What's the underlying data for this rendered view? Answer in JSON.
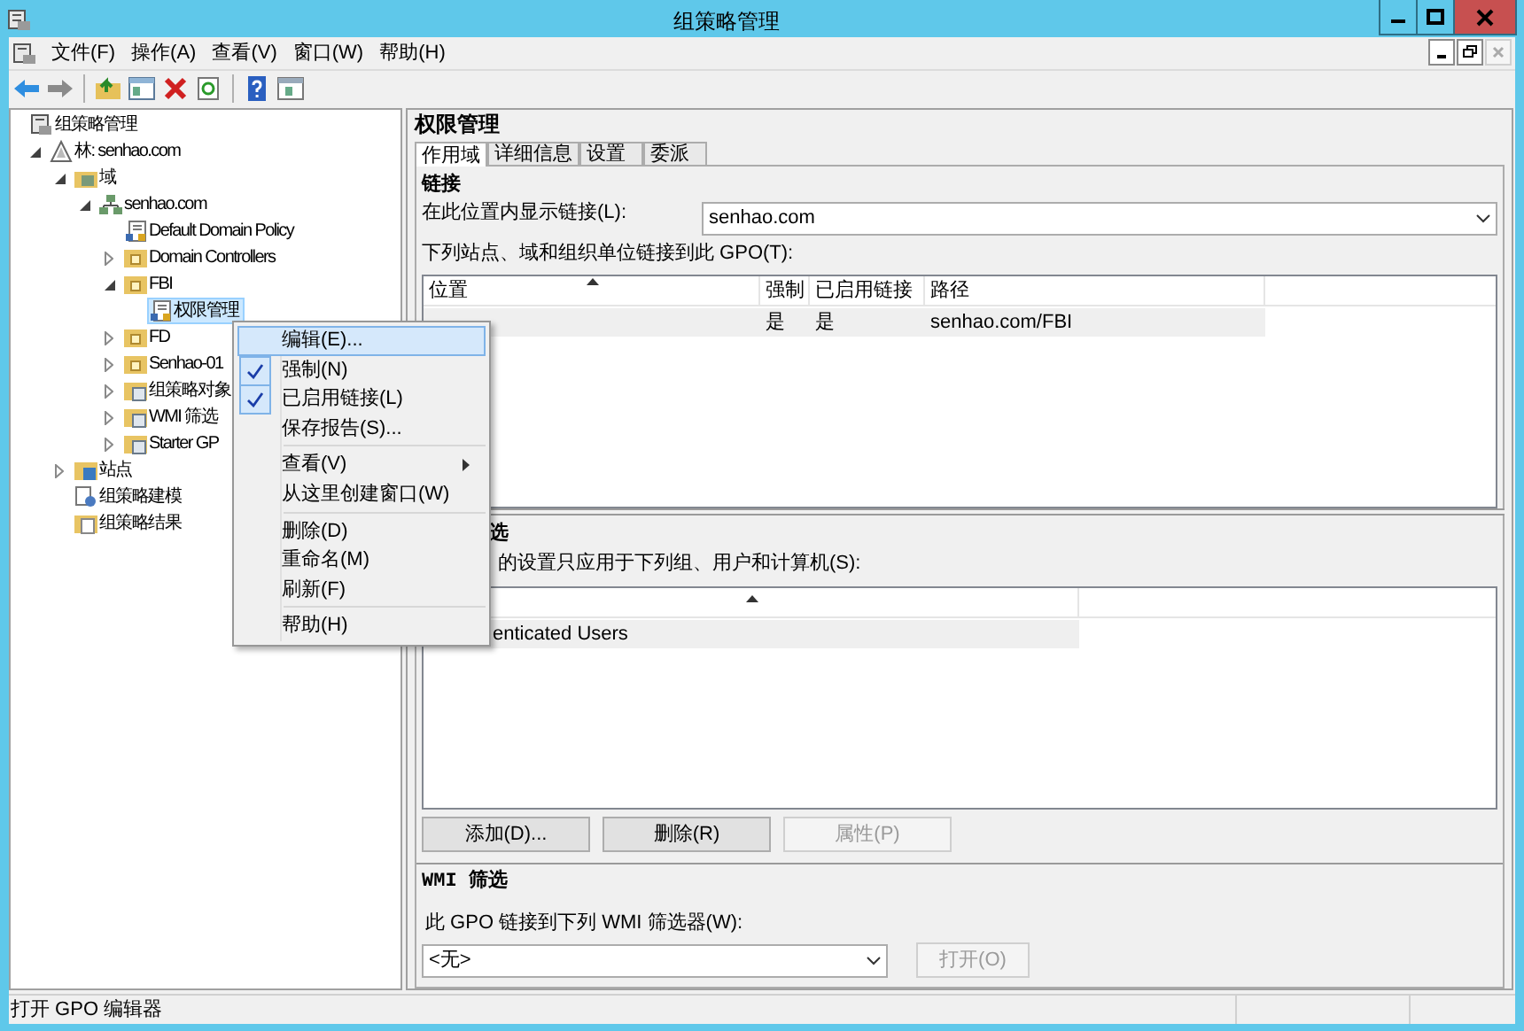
{
  "window": {
    "title": "组策略管理"
  },
  "menu_bar": [
    "文件(F)",
    "操作(A)",
    "查看(V)",
    "窗口(W)",
    "帮助(H)"
  ],
  "tree": [
    {
      "label": "组策略管理",
      "kind": "root",
      "selected": false,
      "children": [
        {
          "label": "林: senhao.com",
          "kind": "forest",
          "selected": false,
          "expanded": true,
          "children": [
            {
              "label": "域",
              "kind": "domains",
              "selected": false,
              "expanded": true,
              "children": [
                {
                  "label": "senhao.com",
                  "kind": "domain",
                  "selected": false,
                  "expanded": true,
                  "children": [
                    {
                      "label": "Default Domain Policy",
                      "kind": "gpo",
                      "selected": false
                    },
                    {
                      "label": "Domain Controllers",
                      "kind": "ou",
                      "selected": false,
                      "expanded": false
                    },
                    {
                      "label": "FBI",
                      "kind": "ou",
                      "selected": false,
                      "expanded": true,
                      "children": [
                        {
                          "label": "权限管理",
                          "kind": "gpo",
                          "selected": true
                        }
                      ]
                    },
                    {
                      "label": "FD",
                      "kind": "ou",
                      "selected": false,
                      "expanded": false
                    },
                    {
                      "label": "Senhao-01",
                      "kind": "ou",
                      "selected": false,
                      "expanded": false
                    },
                    {
                      "label": "组策略对象",
                      "kind": "container",
                      "selected": false,
                      "expanded": false
                    },
                    {
                      "label": "WMI 筛选",
                      "kind": "container",
                      "selected": false,
                      "expanded": false
                    },
                    {
                      "label": "Starter GP",
                      "kind": "container",
                      "selected": false,
                      "expanded": false
                    }
                  ]
                }
              ]
            },
            {
              "label": "站点",
              "kind": "sites",
              "selected": false,
              "expanded": false
            },
            {
              "label": "组策略建模",
              "kind": "modeling",
              "selected": false
            },
            {
              "label": "组策略结果",
              "kind": "results",
              "selected": false
            }
          ]
        }
      ]
    }
  ],
  "detail": {
    "title": "权限管理",
    "tabs": [
      {
        "label": "作用域",
        "selected": true
      },
      {
        "label": "详细信息",
        "selected": false
      },
      {
        "label": "设置",
        "selected": false
      },
      {
        "label": "委派",
        "selected": false
      }
    ],
    "links": {
      "heading": "链接",
      "location_label": "在此位置内显示链接(L):",
      "location_value": "senhao.com",
      "table_label": "下列站点、域和组织单位链接到此 GPO(T):",
      "columns": [
        "位置",
        "强制",
        "已启用链接",
        "路径"
      ],
      "rows": [
        {
          "enforced": "是",
          "enabled": "是",
          "path": "senhao.com/FBI"
        }
      ]
    },
    "security_filtering": {
      "heading": "选",
      "description": "的设置只应用于下列组、用户和计算机(S):",
      "rows": [
        "enticated Users"
      ],
      "buttons": [
        {
          "label": "添加(D)...",
          "disabled": false
        },
        {
          "label": "删除(R)",
          "disabled": false
        },
        {
          "label": "属性(P)",
          "disabled": true
        }
      ]
    },
    "wmi_filtering": {
      "heading": "WMI 筛选",
      "label": "此 GPO 链接到下列 WMI 筛选器(W):",
      "value": "<无>",
      "button": {
        "label": "打开(O)",
        "disabled": true
      }
    }
  },
  "context_menu": [
    {
      "kind": "item",
      "label": "编辑(E)...",
      "selected": true,
      "checked": false,
      "submenu": false
    },
    {
      "kind": "item",
      "label": "强制(N)",
      "selected": false,
      "checked": true,
      "submenu": false
    },
    {
      "kind": "item",
      "label": "已启用链接(L)",
      "selected": false,
      "checked": true,
      "submenu": false
    },
    {
      "kind": "item",
      "label": "保存报告(S)...",
      "selected": false,
      "checked": false,
      "submenu": false
    },
    {
      "kind": "separator"
    },
    {
      "kind": "item",
      "label": "查看(V)",
      "selected": false,
      "checked": false,
      "submenu": true
    },
    {
      "kind": "item",
      "label": "从这里创建窗口(W)",
      "selected": false,
      "checked": false,
      "submenu": false
    },
    {
      "kind": "separator"
    },
    {
      "kind": "item",
      "label": "删除(D)",
      "selected": false,
      "checked": false,
      "submenu": false
    },
    {
      "kind": "item",
      "label": "重命名(M)",
      "selected": false,
      "checked": false,
      "submenu": false
    },
    {
      "kind": "item",
      "label": "刷新(F)",
      "selected": false,
      "checked": false,
      "submenu": false
    },
    {
      "kind": "separator"
    },
    {
      "kind": "item",
      "label": "帮助(H)",
      "selected": false,
      "checked": false,
      "submenu": false
    }
  ],
  "status_bar": "打开 GPO 编辑器"
}
